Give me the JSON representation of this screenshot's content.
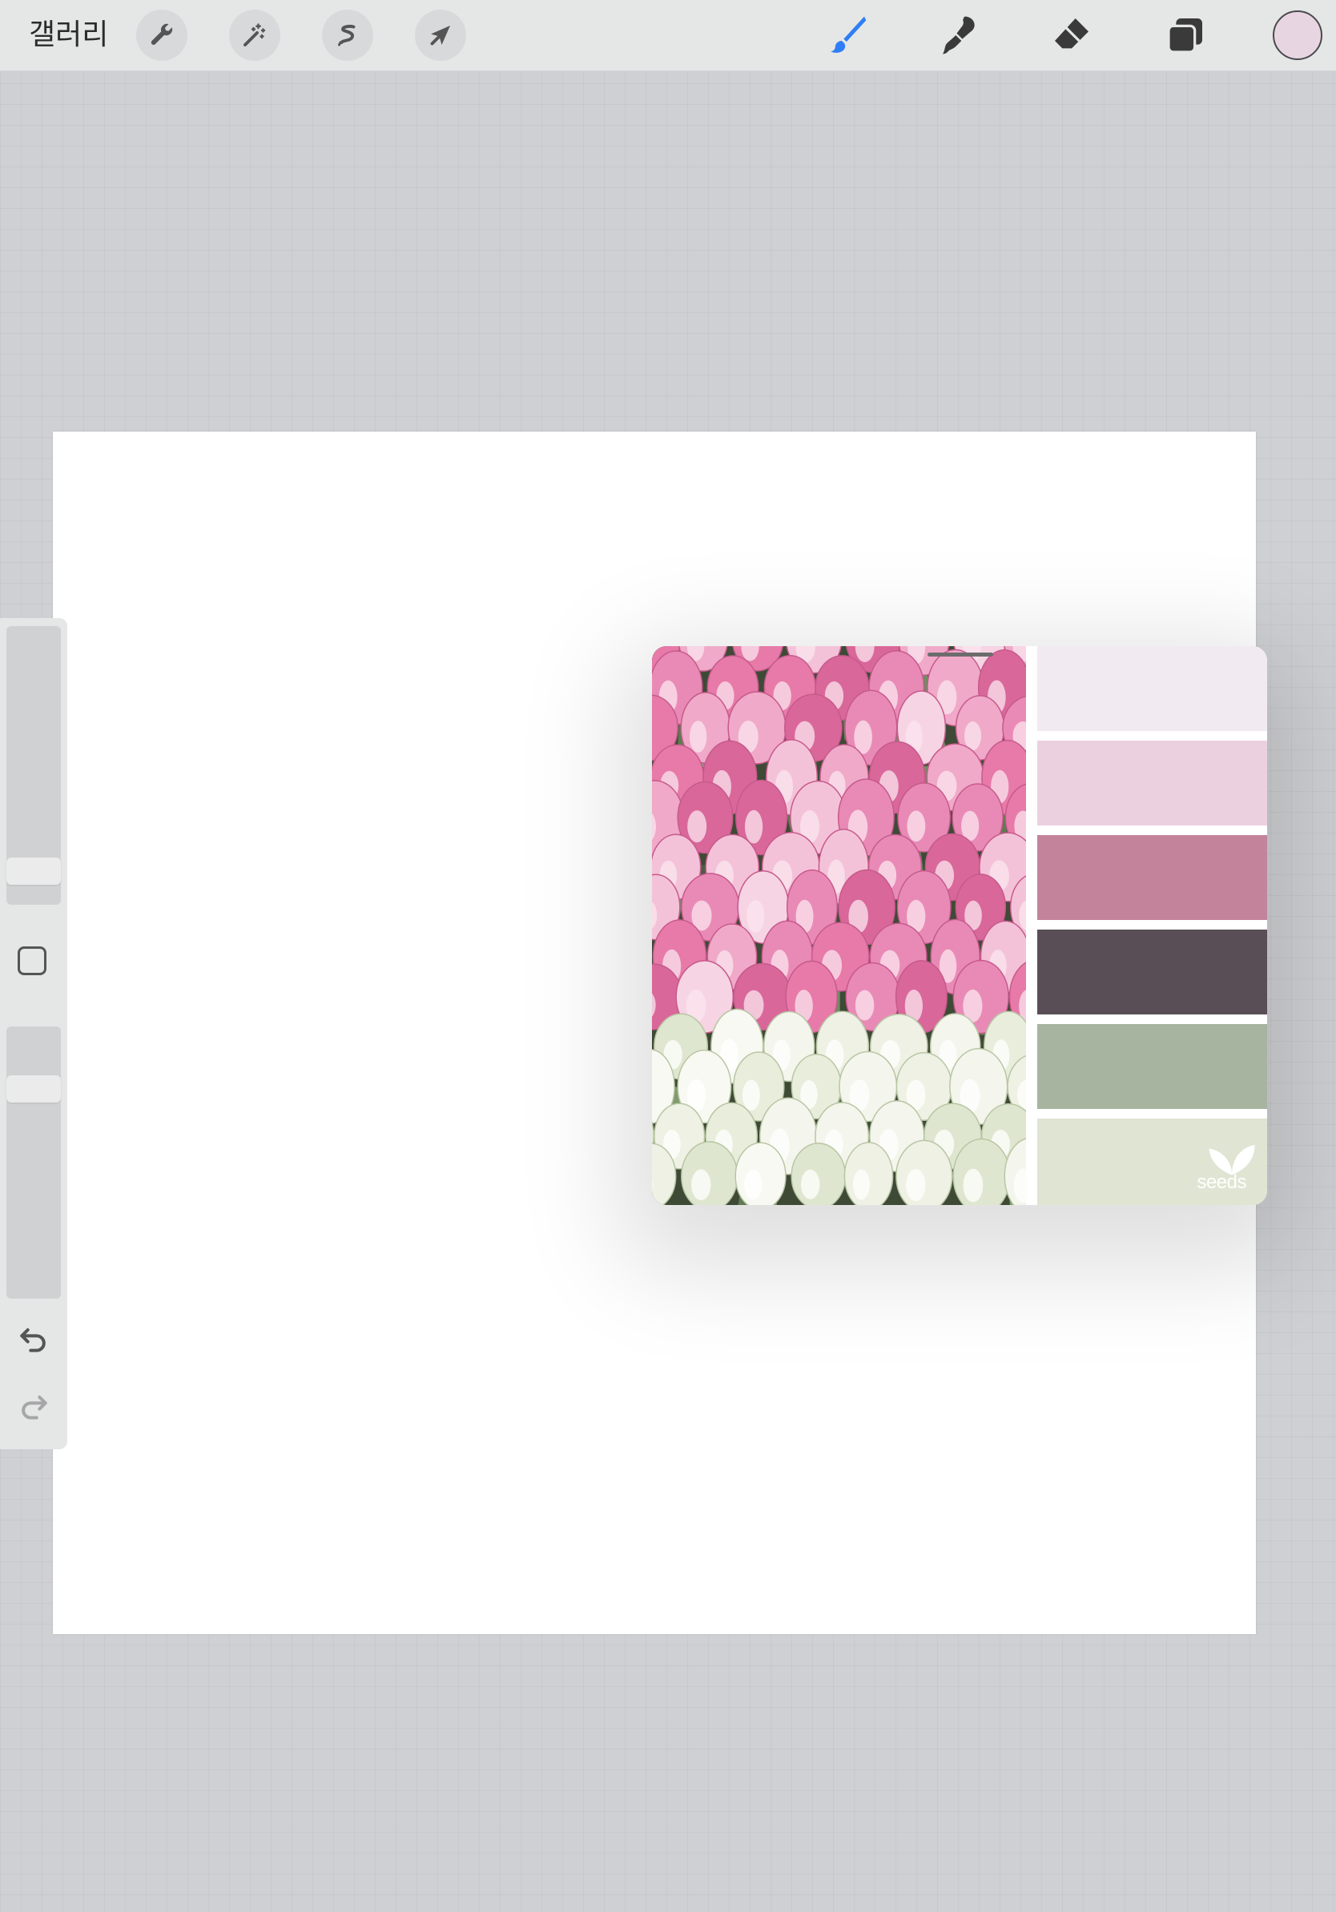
{
  "toolbar": {
    "gallery_label": "갤러리",
    "left_tools": [
      {
        "name": "wrench-icon",
        "label": "actions"
      },
      {
        "name": "magic-wand-icon",
        "label": "adjustments"
      },
      {
        "name": "selection-icon",
        "label": "selection"
      },
      {
        "name": "arrow-cursor-icon",
        "label": "transform"
      }
    ],
    "right_tools": [
      {
        "name": "brush-icon",
        "active": true
      },
      {
        "name": "smudge-icon",
        "active": false
      },
      {
        "name": "eraser-icon",
        "active": false
      },
      {
        "name": "layers-icon",
        "active": false
      }
    ],
    "current_color": "#e8d5e2",
    "accent_color": "#2f7ef5"
  },
  "sidebar": {
    "brush_size_level": 0.08,
    "opacity_level": 0.8,
    "icons": [
      "square-modify-icon",
      "undo-icon",
      "redo-icon"
    ]
  },
  "reference": {
    "palette_colors": [
      "#f2eaf1",
      "#ebd1e0",
      "#c3849b",
      "#5a4e56",
      "#a6b4a0",
      "#e0e5d3"
    ],
    "logo_text": "seeds"
  }
}
